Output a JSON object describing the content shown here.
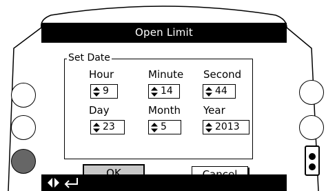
{
  "header": {
    "title": "Open Limit"
  },
  "group": {
    "legend": "Set Date"
  },
  "fields": [
    {
      "label": "Hour",
      "value": "9"
    },
    {
      "label": "Minute",
      "value": "14"
    },
    {
      "label": "Second",
      "value": "44"
    },
    {
      "label": "Day",
      "value": "23"
    },
    {
      "label": "Month",
      "value": "5"
    },
    {
      "label": "Year",
      "value": "2013"
    }
  ],
  "buttons": {
    "ok_label": "OK",
    "cancel_label": "Cancel"
  },
  "colors": {
    "bar": "#000000",
    "ok_button": "#c8c8c8",
    "side_button_active": "#666666"
  },
  "icons": {
    "stepper": "up-down-arrow-icon",
    "nav": "left-right-arrow-icon",
    "back": "back-enter-icon"
  }
}
